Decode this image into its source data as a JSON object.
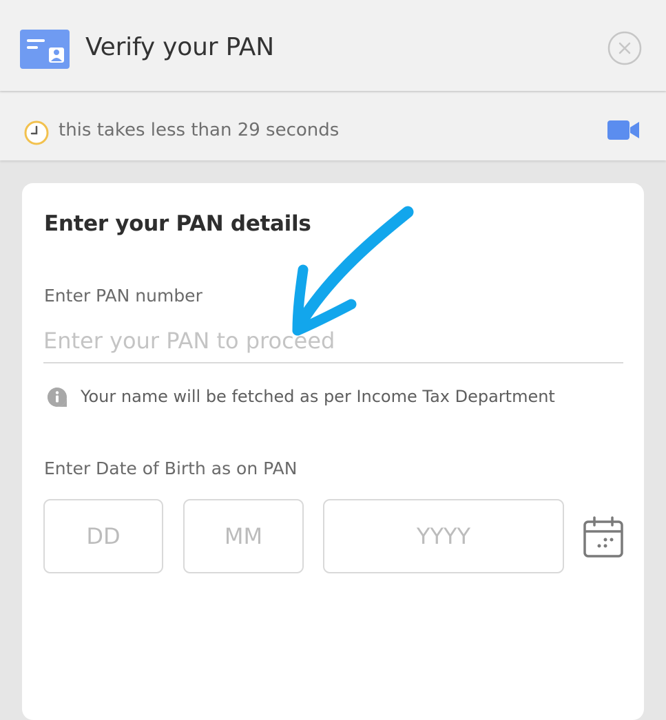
{
  "header": {
    "title": "Verify your PAN",
    "icon": "id-card-icon",
    "close_icon": "close-icon"
  },
  "timer": {
    "text": "this takes less than 29 seconds",
    "clock_icon": "clock-icon",
    "video_icon": "video-camera-icon"
  },
  "form": {
    "title": "Enter your PAN details",
    "pan_label": "Enter PAN number",
    "pan_value": "",
    "pan_placeholder": "Enter your PAN to proceed",
    "info_text": "Your name will be fetched as per Income Tax Department",
    "dob_label": "Enter Date of Birth as on PAN",
    "dob_dd_placeholder": "DD",
    "dob_mm_placeholder": "MM",
    "dob_yyyy_placeholder": "YYYY",
    "calendar_icon": "calendar-icon"
  },
  "colors": {
    "accent_blue": "#5b8def",
    "annotation_arrow": "#12a6ec",
    "clock_ring": "#f2c14e"
  }
}
